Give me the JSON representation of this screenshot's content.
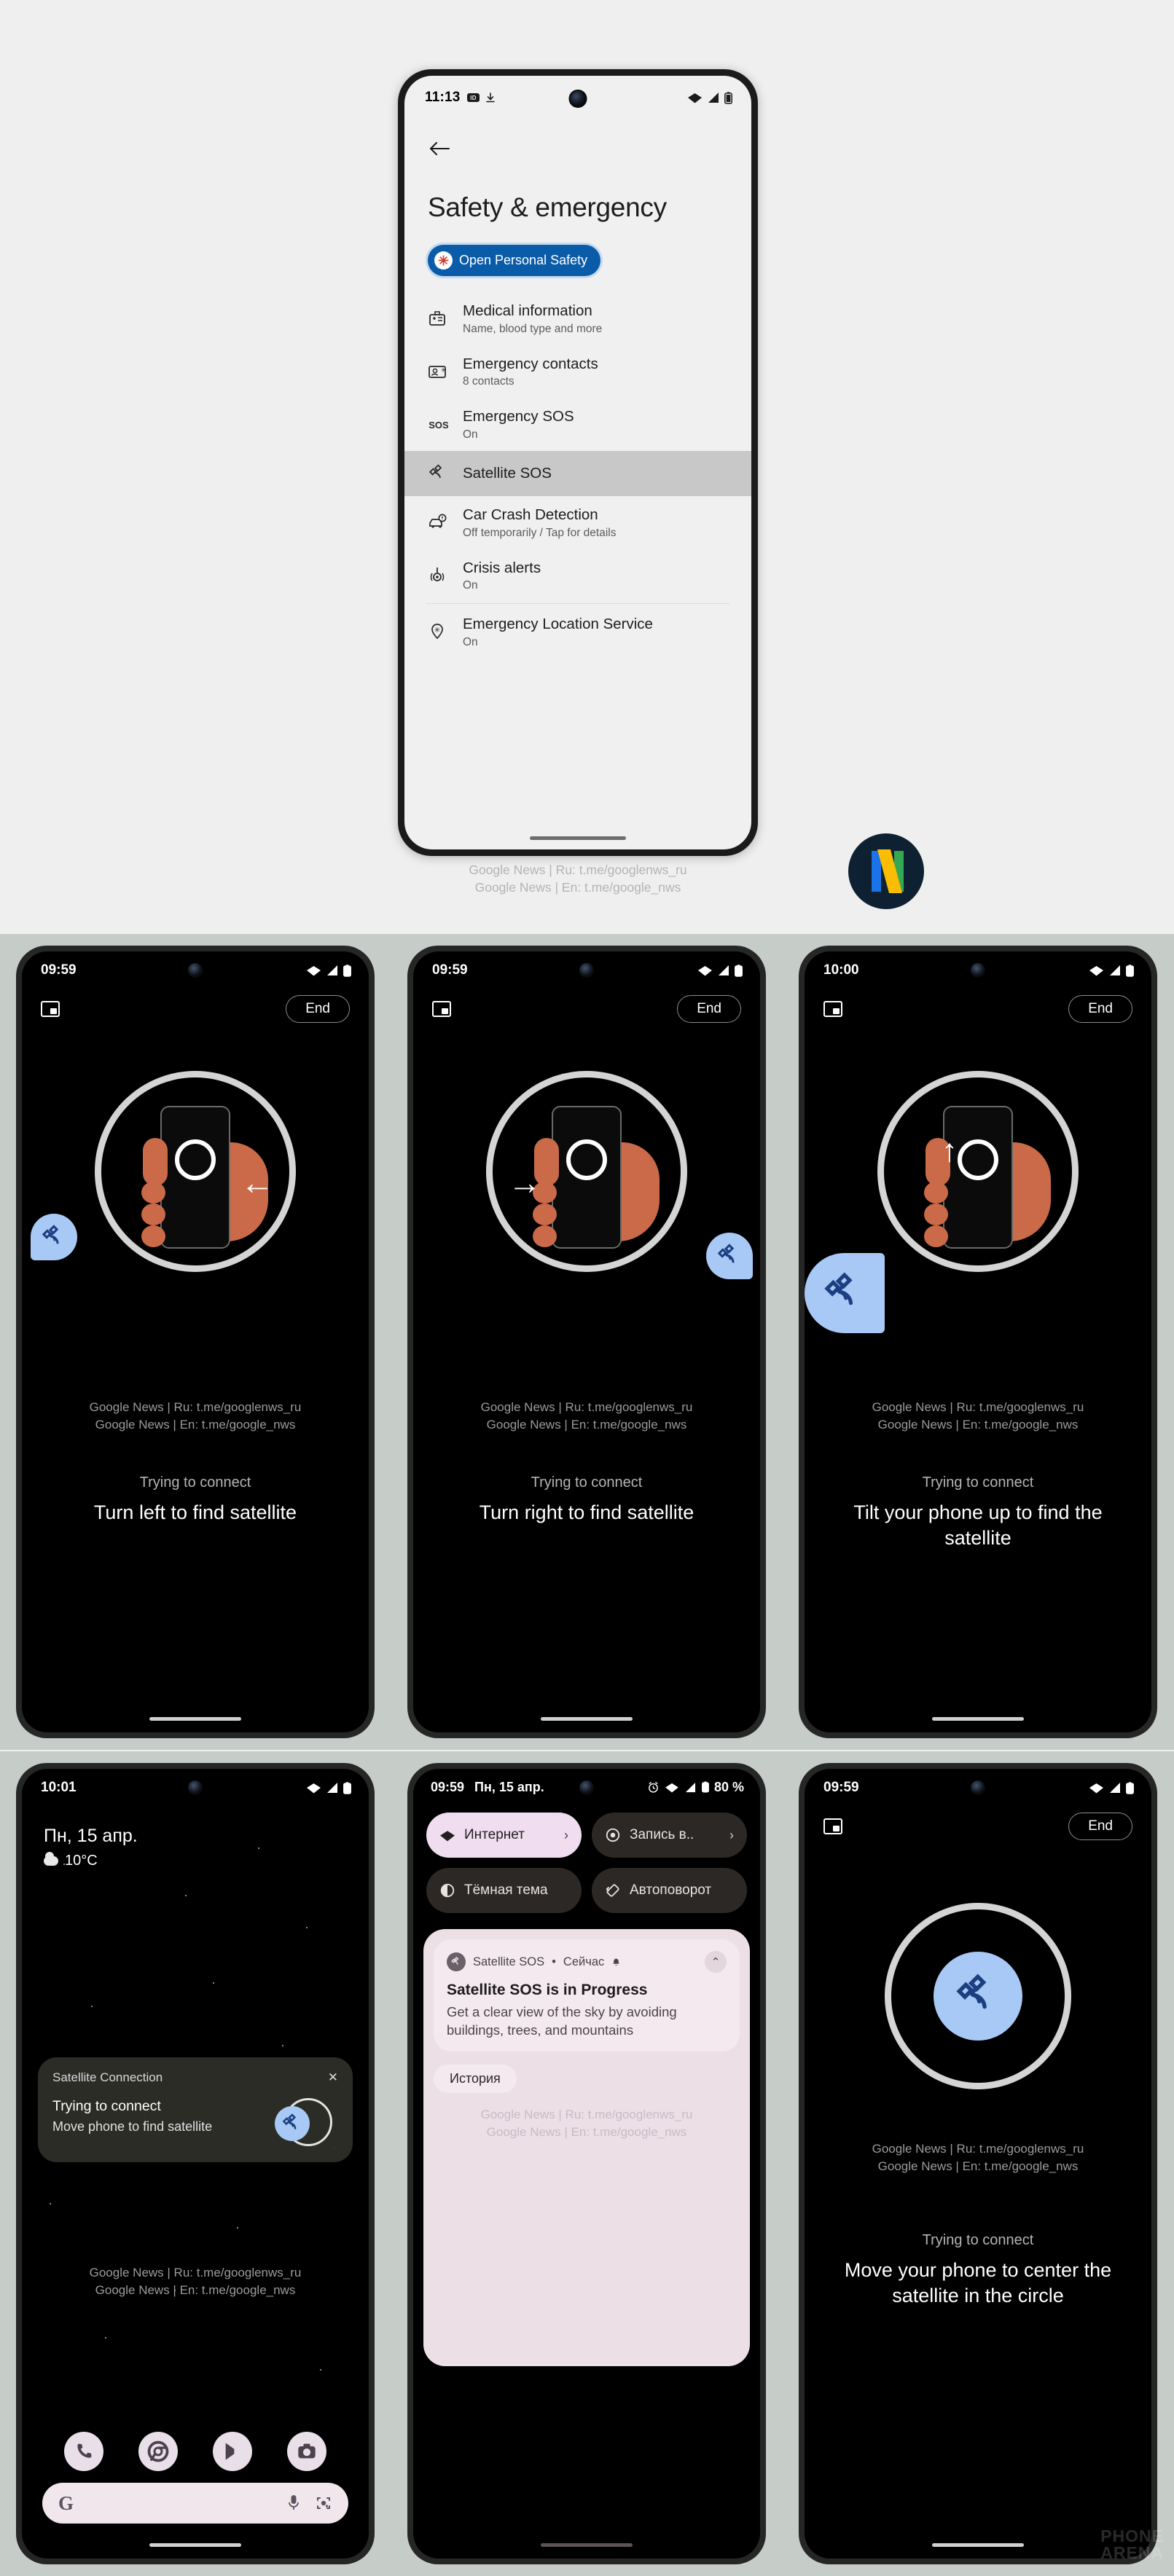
{
  "top_phone": {
    "statusbar": {
      "time": "11:13",
      "icons": [
        "hd-icon",
        "download-icon",
        "wifi-icon",
        "signal-icon",
        "battery-icon"
      ]
    },
    "back_icon": "back-arrow-icon",
    "page_title": "Safety & emergency",
    "personal_safety_chip": {
      "label": "Open Personal Safety",
      "icon": "medical-star-icon"
    },
    "settings": [
      {
        "icon": "medical-id-icon",
        "title": "Medical information",
        "subtitle": "Name, blood type and more"
      },
      {
        "icon": "contact-card-icon",
        "title": "Emergency contacts",
        "subtitle": "8 contacts"
      },
      {
        "icon": "sos-icon",
        "title": "Emergency SOS",
        "subtitle": "On"
      },
      {
        "icon": "satellite-icon",
        "title": "Satellite SOS",
        "subtitle": ""
      },
      {
        "icon": "car-crash-icon",
        "title": "Car Crash Detection",
        "subtitle": "Off temporarily / Tap for details"
      },
      {
        "icon": "crisis-alert-icon",
        "title": "Crisis alerts",
        "subtitle": "On"
      },
      {
        "icon": "location-pin-icon",
        "title": "Emergency Location Service",
        "subtitle": "On"
      }
    ]
  },
  "watermark": {
    "line1": "Google News | Ru: t.me/googlenws_ru",
    "line2": "Google News | En: t.me/google_nws"
  },
  "news_logo": {
    "name": "google-news-logo",
    "letter": "N"
  },
  "phones": {
    "turn_left": {
      "statusbar": {
        "time": "09:59"
      },
      "end_button": "End",
      "pip_icon": "picture-in-picture-icon",
      "arrow": "←",
      "status_sub": "Trying to connect",
      "status_main": "Turn left to find satellite"
    },
    "turn_right": {
      "statusbar": {
        "time": "09:59"
      },
      "end_button": "End",
      "pip_icon": "picture-in-picture-icon",
      "arrow": "→",
      "status_sub": "Trying to connect",
      "status_main": "Turn right to find satellite"
    },
    "tilt_up": {
      "statusbar": {
        "time": "10:00"
      },
      "end_button": "End",
      "pip_icon": "picture-in-picture-icon",
      "arrow": "↑",
      "status_sub": "Trying to connect",
      "status_main": "Tilt your phone up to find the satellite"
    },
    "lockscreen": {
      "statusbar": {
        "time": "10:01"
      },
      "date": "Пн, 15 апр.",
      "temperature": "10°C",
      "notification": {
        "app": "Satellite Connection",
        "close_icon": "close-icon",
        "line1": "Trying to connect",
        "line2": "Move phone to find satellite"
      },
      "dock": [
        "phone-icon",
        "chrome-icon",
        "play-store-icon",
        "camera-icon"
      ],
      "search": {
        "g_icon": "google-g-icon",
        "mic_icon": "microphone-icon",
        "lens_icon": "google-lens-icon",
        "placeholder": ""
      }
    },
    "quick_settings": {
      "statusbar": {
        "time": "09:59",
        "date": "Пн, 15 апр.",
        "battery": "80 %",
        "icons": [
          "alarm-icon",
          "wifi-icon",
          "signal-icon",
          "battery-icon"
        ]
      },
      "tiles": [
        {
          "label": "Интернет",
          "icon": "wifi-icon",
          "active": true,
          "chevron": "›"
        },
        {
          "label": "Запись в..",
          "icon": "screen-record-icon",
          "active": false,
          "chevron": "›"
        },
        {
          "label": "Тёмная тема",
          "icon": "dark-theme-icon",
          "active": false,
          "chevron": ""
        },
        {
          "label": "Автоповорот",
          "icon": "auto-rotate-icon",
          "active": false,
          "chevron": ""
        }
      ],
      "notification": {
        "app": "Satellite SOS",
        "separator": "•",
        "time": "Сейчас",
        "bell_icon": "bell-icon",
        "expand_icon": "chevron-up-icon",
        "title": "Satellite SOS is in Progress",
        "body": "Get a clear view of the sky by avoiding buildings, trees, and mountains"
      },
      "history_button": "История"
    },
    "center_satellite": {
      "statusbar": {
        "time": "09:59"
      },
      "end_button": "End",
      "pip_icon": "picture-in-picture-icon",
      "status_sub": "Trying to connect",
      "status_main": "Move your phone to center the satellite in the circle"
    }
  },
  "source_watermark": {
    "line1": "PHONE",
    "line2": "ARENA"
  },
  "colors": {
    "page_bg": "#efefef",
    "band_bg": "#c6cdc9",
    "accent_blue": "#0b5ca8",
    "satellite_blue": "#a8c8f5",
    "satellite_dark": "#1b3f80",
    "skin": "#cb6a48",
    "highlight_row": "#c8c8c8"
  }
}
